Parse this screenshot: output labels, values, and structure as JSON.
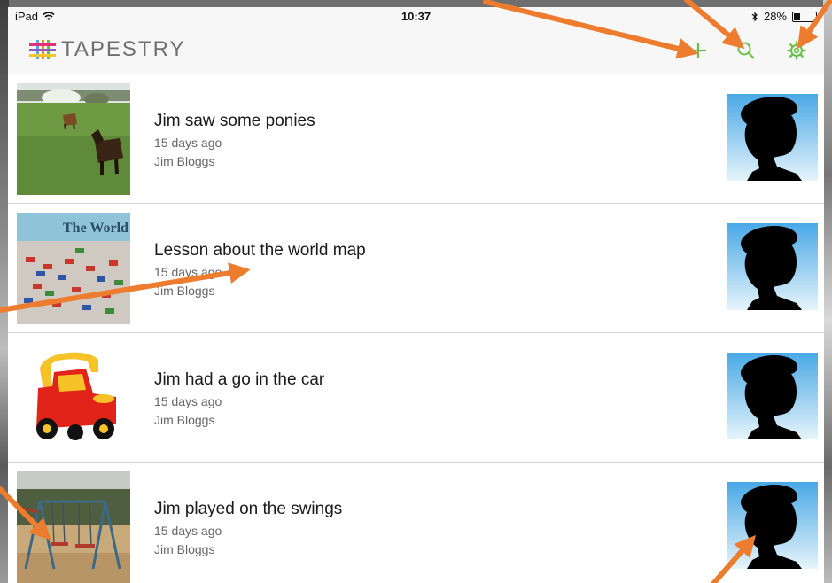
{
  "status_bar": {
    "device": "iPad",
    "time": "10:37",
    "battery_percent": "28%",
    "battery_level": 0.28
  },
  "app": {
    "name": "TAPESTRY",
    "accent_color": "#6cc04a"
  },
  "nav": {
    "icons": [
      "add-icon",
      "search-icon",
      "settings-gear-icon"
    ]
  },
  "observations": [
    {
      "title": "Jim saw some ponies",
      "time": "15 days ago",
      "author": "Jim Bloggs",
      "thumbnail": "field-with-ponies"
    },
    {
      "title": "Lesson about the world map",
      "time": "15 days ago",
      "author": "Jim Bloggs",
      "thumbnail": "world-map-with-flags",
      "thumb_caption": "The World"
    },
    {
      "title": "Jim had a go in the car",
      "time": "15 days ago",
      "author": "Jim Bloggs",
      "thumbnail": "red-yellow-toy-car"
    },
    {
      "title": "Jim played on the swings",
      "time": "15 days ago",
      "author": "Jim Bloggs",
      "thumbnail": "playground-swings"
    }
  ],
  "annotation": {
    "arrow_color": "#ee7c2e"
  }
}
